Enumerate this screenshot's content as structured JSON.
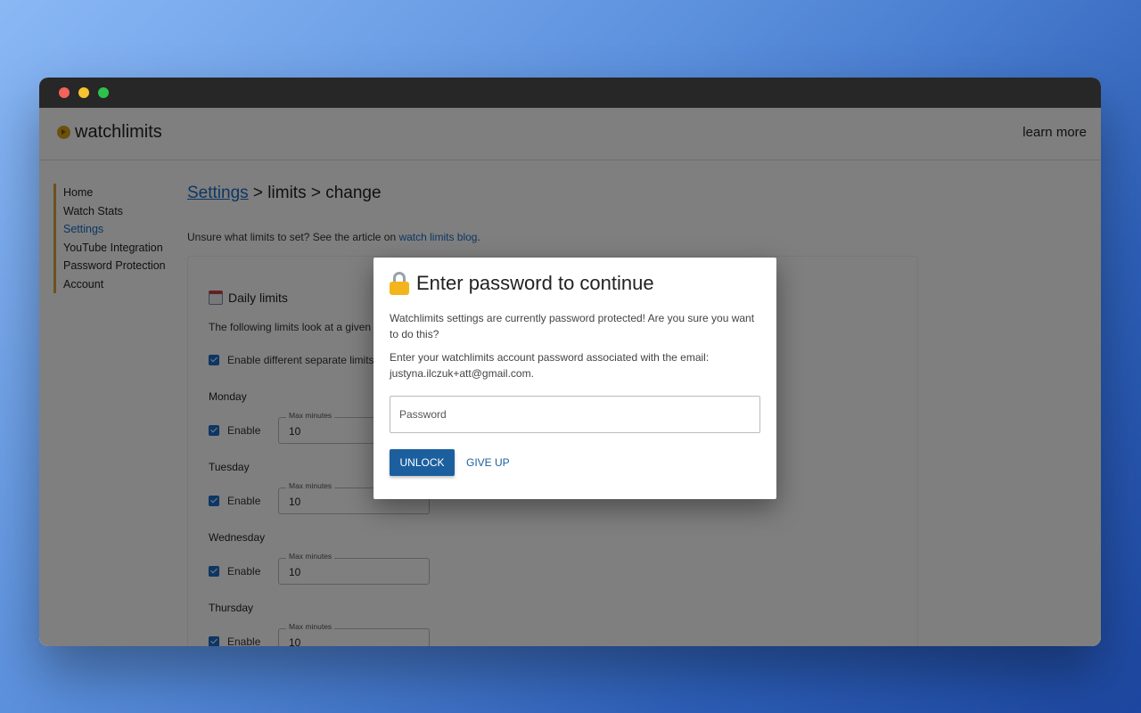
{
  "app": {
    "name": "watchlimits",
    "learn_more": "learn more"
  },
  "sidebar": {
    "items": [
      {
        "label": "Home"
      },
      {
        "label": "Watch Stats"
      },
      {
        "label": "Settings"
      },
      {
        "label": "YouTube Integration"
      },
      {
        "label": "Password Protection"
      },
      {
        "label": "Account"
      }
    ],
    "active": "Settings"
  },
  "breadcrumb": {
    "root": "Settings",
    "rest": " > limits > change"
  },
  "hint": {
    "prefix": "Unsure what limits to set? See the article on ",
    "link": "watch limits blog",
    "suffix": "."
  },
  "card": {
    "title": "Daily limits",
    "text": "The following limits look at a given",
    "separate_limits_label": "Enable different separate limits",
    "days": [
      {
        "name": "Monday",
        "enable_label": "Enable",
        "field_label": "Max minutes",
        "value": "10"
      },
      {
        "name": "Tuesday",
        "enable_label": "Enable",
        "field_label": "Max minutes",
        "value": "10"
      },
      {
        "name": "Wednesday",
        "enable_label": "Enable",
        "field_label": "Max minutes",
        "value": "10"
      },
      {
        "name": "Thursday",
        "enable_label": "Enable",
        "field_label": "Max minutes",
        "value": "10"
      }
    ]
  },
  "modal": {
    "title": "Enter password to continue",
    "text1": "Watchlimits settings are currently password protected! Are you sure you want to do this?",
    "text2": "Enter your watchlimits account password associated with the email: justyna.ilczuk+att@gmail.com.",
    "password_placeholder": "Password",
    "unlock_label": "UNLOCK",
    "giveup_label": "GIVE UP"
  },
  "colors": {
    "accent": "#1b5f9e",
    "link": "#1a6dc9",
    "brand": "#d9a21b"
  }
}
